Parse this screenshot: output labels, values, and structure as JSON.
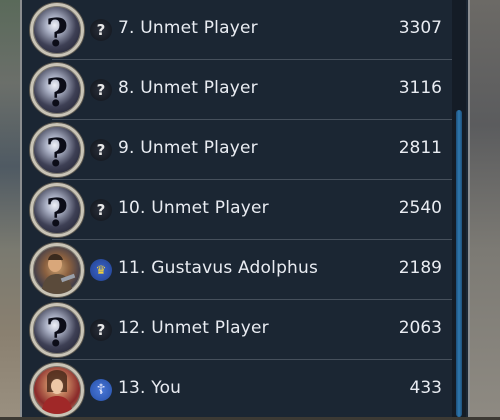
{
  "leaderboard": {
    "rows": [
      {
        "rank_name": "7. Unmet Player",
        "score": "3307",
        "portrait": "unmet-portrait",
        "badge_icon": "question-mark-icon",
        "badge_text": "?"
      },
      {
        "rank_name": "8. Unmet Player",
        "score": "3116",
        "portrait": "unmet-portrait",
        "badge_icon": "question-mark-icon",
        "badge_text": "?"
      },
      {
        "rank_name": "9. Unmet Player",
        "score": "2811",
        "portrait": "unmet-portrait",
        "badge_icon": "question-mark-icon",
        "badge_text": "?"
      },
      {
        "rank_name": "10. Unmet Player",
        "score": "2540",
        "portrait": "unmet-portrait",
        "badge_icon": "question-mark-icon",
        "badge_text": "?"
      },
      {
        "rank_name": "11. Gustavus Adolphus",
        "score": "2189",
        "portrait": "gustavus-adolphus-portrait",
        "badge_icon": "three-crowns-icon",
        "badge_text": "♛"
      },
      {
        "rank_name": "12. Unmet Player",
        "score": "2063",
        "portrait": "unmet-portrait",
        "badge_icon": "question-mark-icon",
        "badge_text": "?"
      },
      {
        "rank_name": "13. You",
        "score": "433",
        "portrait": "player-leader-portrait",
        "badge_icon": "cross-icon",
        "badge_text": "☦"
      }
    ],
    "portrait_glyph_unmet": "?"
  },
  "colors": {
    "panel_bg": "#1b2633",
    "text": "#e9ecf2",
    "scroll_thumb": "#2f79b0"
  }
}
